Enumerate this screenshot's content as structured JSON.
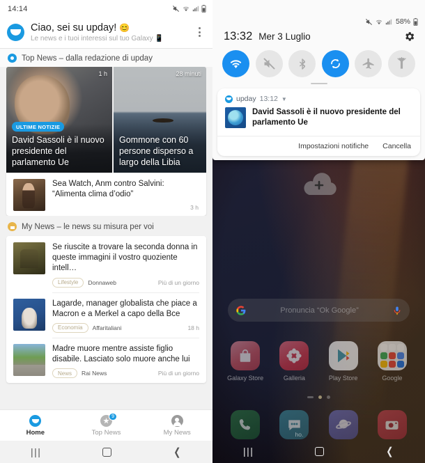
{
  "left_phone": {
    "status_bar": {
      "clock": "14:14",
      "icons": [
        "mute-icon",
        "wifi-icon",
        "signal-icon",
        "battery-icon"
      ]
    },
    "app_header": {
      "logo_icon": "upday-logo-icon",
      "title": "Ciao, sei su upday!",
      "title_emoji": "😊",
      "subtitle": "Le news e i tuoi interessi sul tuo Galaxy 📱",
      "overflow_icon": "kebab-menu-icon"
    },
    "sections": [
      {
        "id": "top-news",
        "icon": "upday-dot-icon",
        "label": "Top News – dalla redazione di upday"
      },
      {
        "id": "my-news",
        "icon": "profile-dot-icon",
        "label": "My News – le news su misura per voi"
      }
    ],
    "hero_cards": [
      {
        "time": "1 h",
        "badge": "ULTIME NOTIZIE",
        "title": "David Sassoli è il nuovo presidente del parlamento Ue",
        "image": "sassoli-portrait"
      },
      {
        "time": "28 minuti",
        "badge": "",
        "title": "Gommone con 60 persone disperso a largo della Libia",
        "image": "boat-at-sea"
      }
    ],
    "top_news_list": [
      {
        "title": "Sea Watch, Anm contro Salvini: “Alimenta clima d’odio”",
        "category": "",
        "source": "",
        "age": "3 h",
        "thumb": "th-seawatch"
      }
    ],
    "my_news_list": [
      {
        "title": "Se riuscite a trovare la seconda donna in queste immagini il vostro quoziente intell…",
        "category": "Lifestyle",
        "source": "Donnaweb",
        "age": "Più di un giorno",
        "thumb": "th-quiz"
      },
      {
        "title": "Lagarde, manager globalista che piace a Macron e a Merkel a capo della Bce",
        "category": "Economia",
        "source": "Affaritaliani",
        "age": "18 h",
        "thumb": "th-lagarde"
      },
      {
        "title": "Madre muore mentre assiste figlio disabile. Lasciato solo muore anche lui",
        "category": "News",
        "source": "Rai News",
        "age": "Più di un giorno",
        "thumb": "th-madre"
      }
    ],
    "tabs": [
      {
        "id": "home",
        "label": "Home",
        "icon": "upday-home-icon",
        "active": true,
        "badge": ""
      },
      {
        "id": "top-news",
        "label": "Top News",
        "icon": "star-icon",
        "active": false,
        "badge": "9"
      },
      {
        "id": "my-news",
        "label": "My News",
        "icon": "person-icon",
        "active": false,
        "badge": ""
      }
    ],
    "nav_bar": {
      "recents_icon": "recents-icon",
      "home_icon": "home-icon",
      "back_icon": "back-icon"
    }
  },
  "right_phone": {
    "status_bar": {
      "battery_percent": "58%",
      "icons": [
        "mute-icon",
        "wifi-icon",
        "signal-icon",
        "battery-icon"
      ]
    },
    "quick_settings": {
      "time": "13:32",
      "date": "Mer 3 Luglio",
      "settings_icon": "gear-icon",
      "accent_color": "#1a8ff0",
      "toggles": [
        {
          "id": "wifi",
          "icon": "wifi-icon",
          "on": true
        },
        {
          "id": "sound",
          "icon": "mute-icon",
          "on": false
        },
        {
          "id": "bluetooth",
          "icon": "bluetooth-icon",
          "on": false
        },
        {
          "id": "auto-rotate",
          "icon": "rotate-icon",
          "on": true
        },
        {
          "id": "airplane-mode",
          "icon": "airplane-icon",
          "on": false
        },
        {
          "id": "flashlight",
          "icon": "flashlight-icon",
          "on": false
        }
      ]
    },
    "notification": {
      "app_name": "upday",
      "time": "13:12",
      "expand_icon": "chevron-down-icon",
      "thumb": "globe-thumb",
      "text": "David Sassoli è il nuovo presidente del parlamento Ue",
      "actions": [
        {
          "id": "settings",
          "label": "Impostazioni notifiche"
        },
        {
          "id": "clear",
          "label": "Cancella"
        }
      ]
    },
    "home_screen": {
      "cloud_icon": "cloud-add-icon",
      "search": {
        "google_icon": "google-g-icon",
        "placeholder": "Pronuncia “Ok Google”",
        "mic_icon": "microphone-icon"
      },
      "apps": [
        {
          "id": "galaxy-store",
          "label": "Galaxy Store",
          "icon": "shopping-bag-icon"
        },
        {
          "id": "galleria",
          "label": "Galleria",
          "icon": "flower-icon"
        },
        {
          "id": "play-store",
          "label": "Play Store",
          "icon": "play-triangle-icon"
        },
        {
          "id": "google",
          "label": "Google",
          "icon": "google-folder-icon"
        }
      ],
      "dock": [
        {
          "id": "phone",
          "label": "",
          "icon": "phone-icon"
        },
        {
          "id": "messages",
          "label": "",
          "icon": "message-icon"
        },
        {
          "id": "internet",
          "label": "",
          "icon": "planet-icon"
        },
        {
          "id": "camera",
          "label": "",
          "icon": "camera-icon"
        }
      ],
      "carrier_label": "ho."
    },
    "nav_bar": {
      "recents_icon": "recents-icon",
      "home_icon": "home-icon",
      "back_icon": "back-icon"
    }
  }
}
